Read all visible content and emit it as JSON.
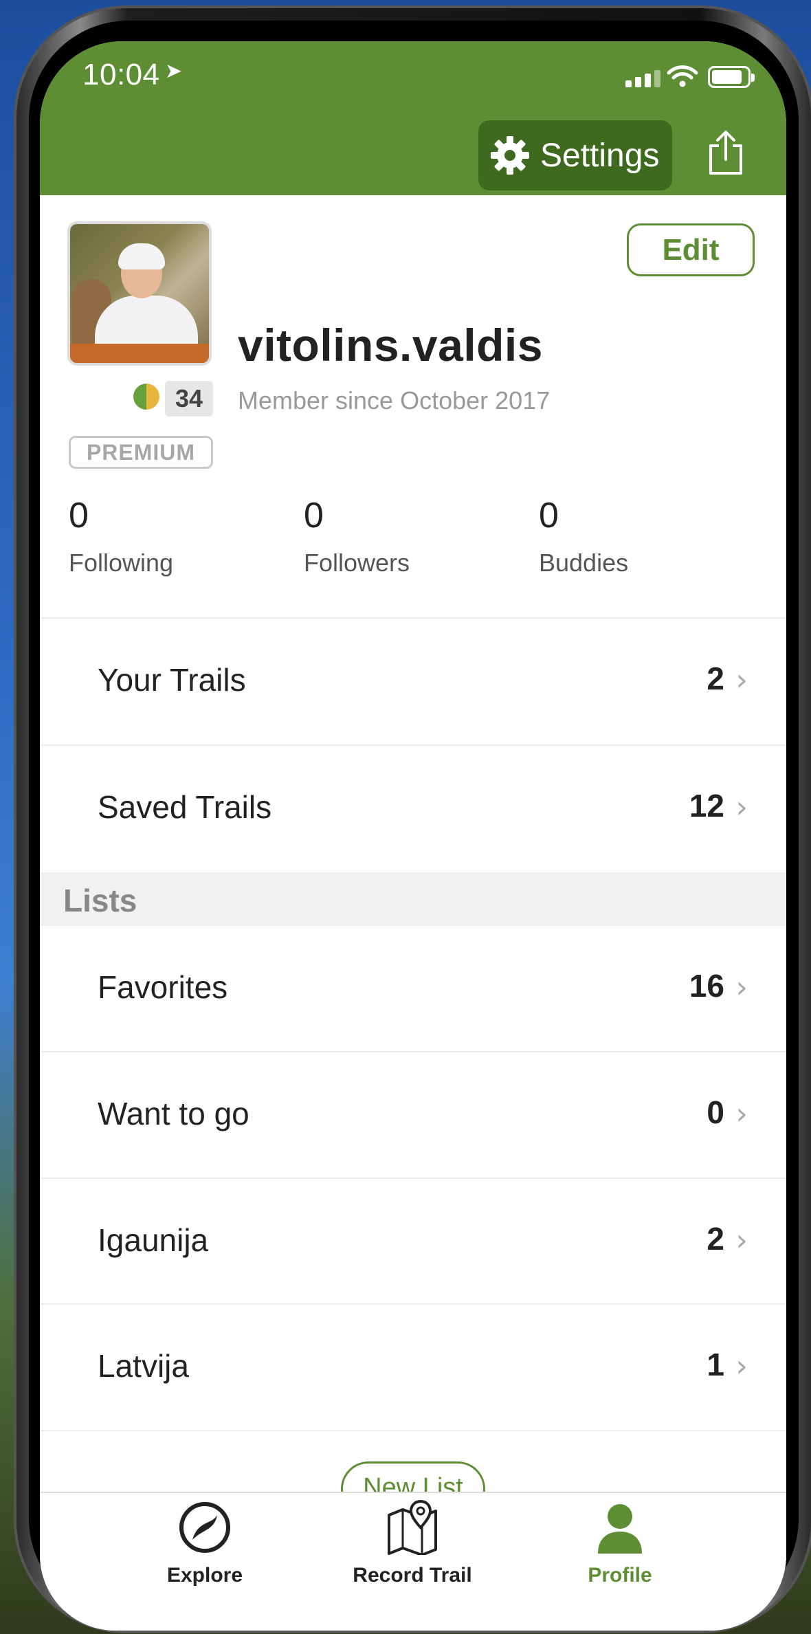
{
  "status_bar": {
    "time": "10:04",
    "location_icon": "location-arrow-icon",
    "signal_icon": "cell-signal-icon",
    "wifi_icon": "wifi-icon",
    "battery_icon": "battery-icon"
  },
  "header": {
    "settings_label": "Settings",
    "settings_icon": "gear-icon",
    "share_icon": "share-icon"
  },
  "profile": {
    "edit_label": "Edit",
    "username": "vitolins.valdis",
    "level": "34",
    "member_since": "Member since October 2017",
    "badge": "PREMIUM"
  },
  "stats": [
    {
      "value": "0",
      "label": "Following"
    },
    {
      "value": "0",
      "label": "Followers"
    },
    {
      "value": "0",
      "label": "Buddies"
    }
  ],
  "trails": [
    {
      "label": "Your Trails",
      "count": "2"
    },
    {
      "label": "Saved Trails",
      "count": "12"
    }
  ],
  "lists_header": "Lists",
  "lists": [
    {
      "label": "Favorites",
      "count": "16"
    },
    {
      "label": "Want to go",
      "count": "0"
    },
    {
      "label": "Igaunija",
      "count": "2"
    },
    {
      "label": "Latvija",
      "count": "1"
    }
  ],
  "new_list_label": "New List",
  "tabs": [
    {
      "label": "Explore",
      "icon": "explore-icon"
    },
    {
      "label": "Record Trail",
      "icon": "map-pin-icon"
    },
    {
      "label": "Profile",
      "icon": "person-icon"
    }
  ],
  "colors": {
    "brand_green": "#5d8e33",
    "settings_button": "#3e6a1f"
  }
}
